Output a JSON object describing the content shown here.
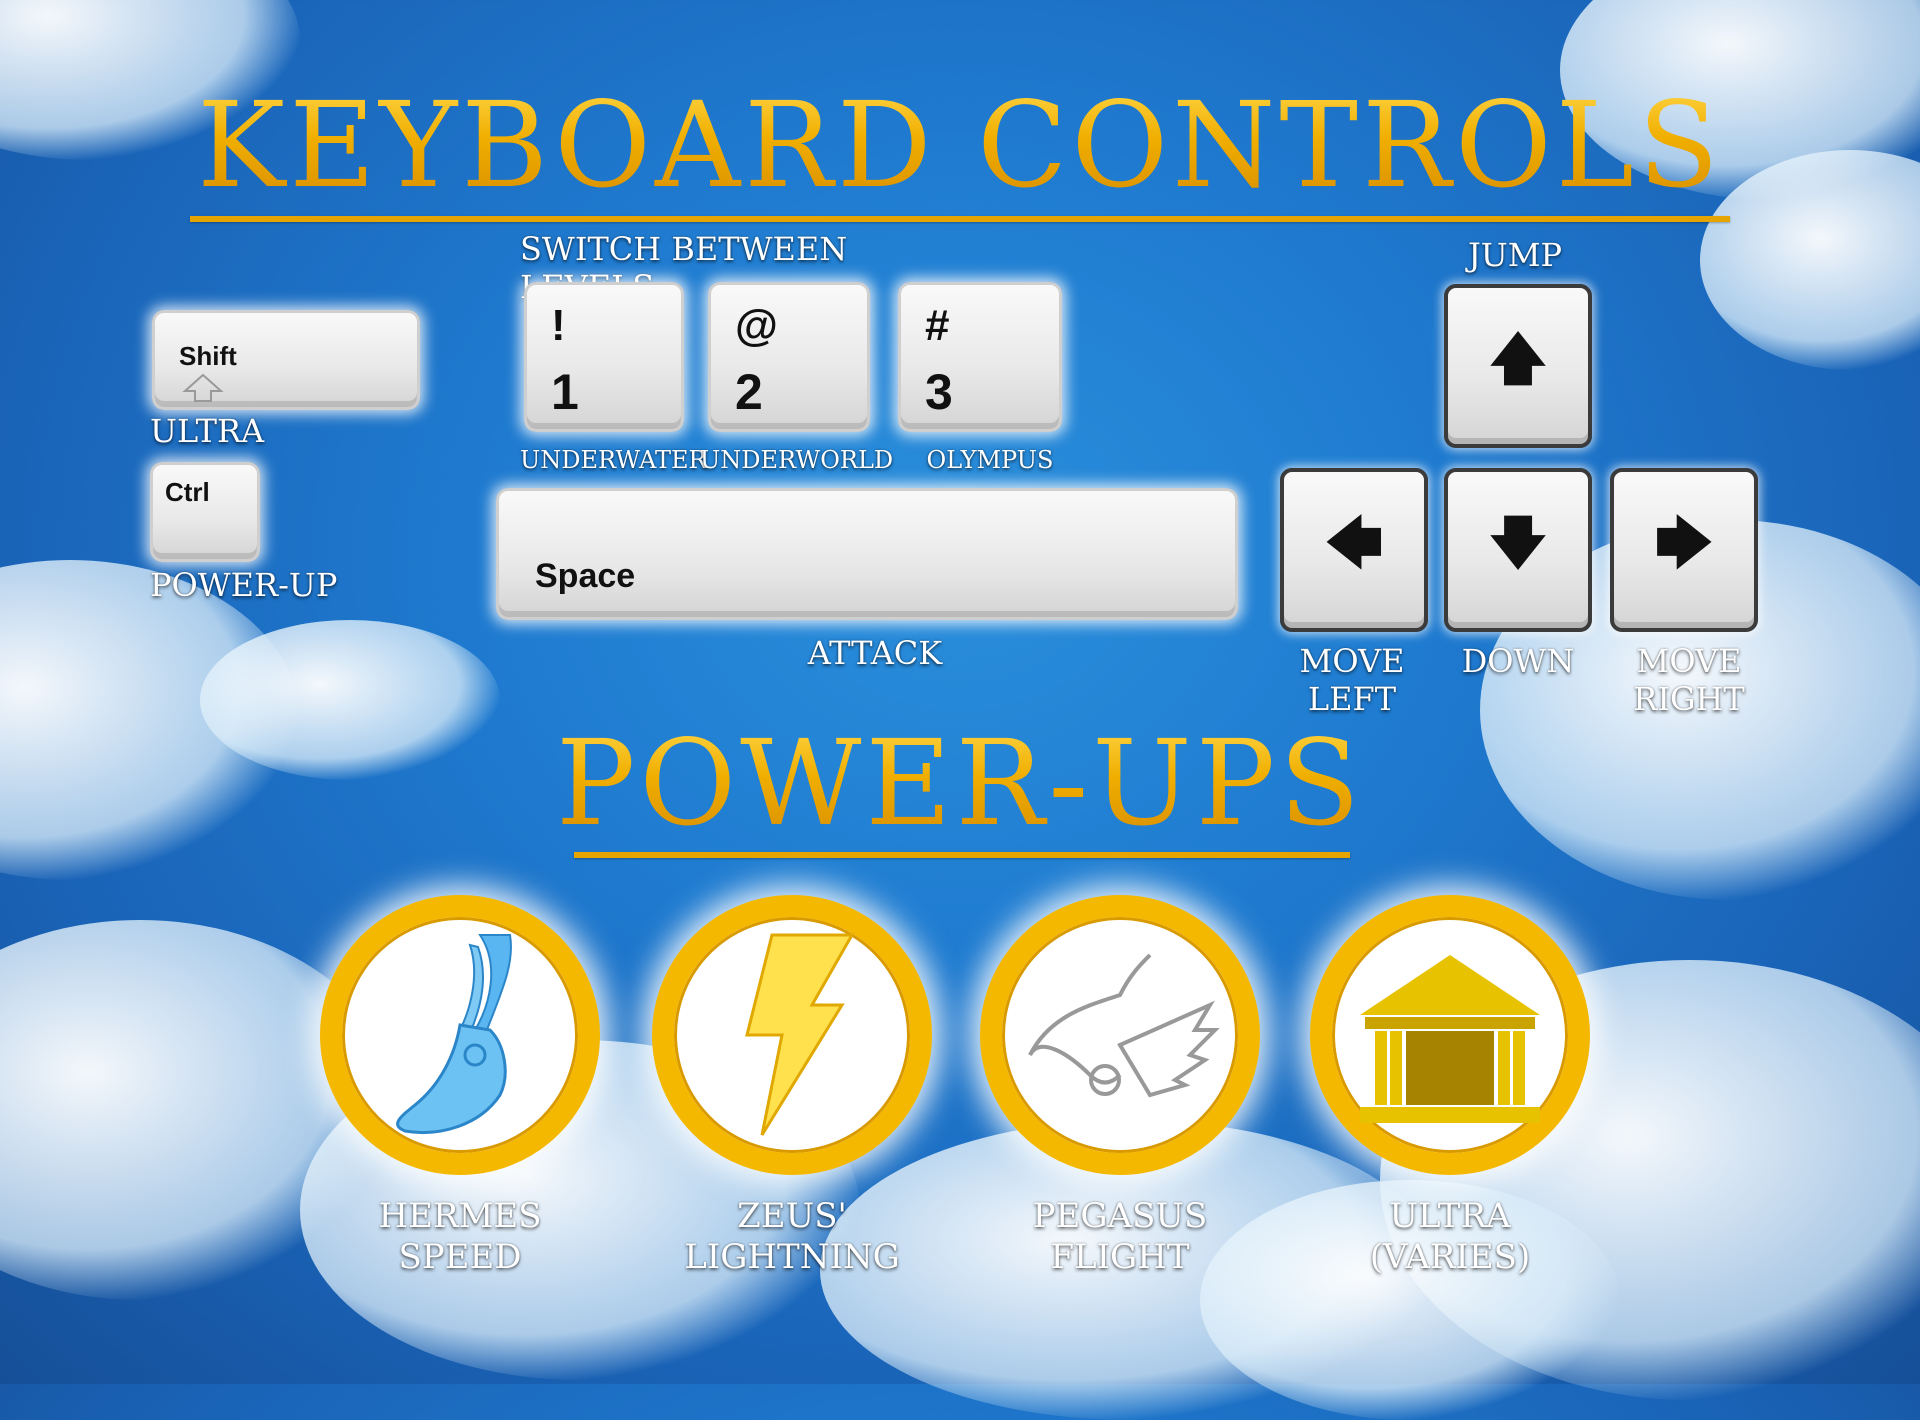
{
  "title_controls": "KEYBOARD CONTROLS",
  "title_powerups": "POWER-UPS",
  "switch_levels_label": "SWITCH BETWEEN LEVELS:",
  "keys": {
    "shift": "Shift",
    "ctrl": "Ctrl",
    "space": "Space",
    "key1_top": "!",
    "key1_bottom": "1",
    "key2_top": "@",
    "key2_bottom": "2",
    "key3_top": "#",
    "key3_bottom": "3",
    "up": "🡅",
    "left": "🡄",
    "down": "🡇",
    "right": "🡆"
  },
  "labels": {
    "ultra": "ULTRA",
    "power_up": "POWER-UP",
    "underwater": "UNDERWATER",
    "underworld": "UNDERWORLD",
    "olympus": "OLYMPUS",
    "attack": "ATTACK",
    "jump": "JUMP",
    "move_left_1": "MOVE",
    "move_left_2": "LEFT",
    "down": "DOWN",
    "move_right_1": "MOVE",
    "move_right_2": "RIGHT"
  },
  "powerups": [
    {
      "line1": "HERMES",
      "line2": "SPEED",
      "icon": "winged-sandal-icon"
    },
    {
      "line1": "ZEUS'",
      "line2": "LIGHTNING",
      "icon": "lightning-bolt-icon"
    },
    {
      "line1": "PEGASUS",
      "line2": "FLIGHT",
      "icon": "pegasus-icon"
    },
    {
      "line1": "ULTRA",
      "line2": "(VARIES)",
      "icon": "temple-icon"
    }
  ],
  "colors": {
    "gold": "#f2b600",
    "sky": "#1f7bd0",
    "key": "#eeeeee"
  }
}
